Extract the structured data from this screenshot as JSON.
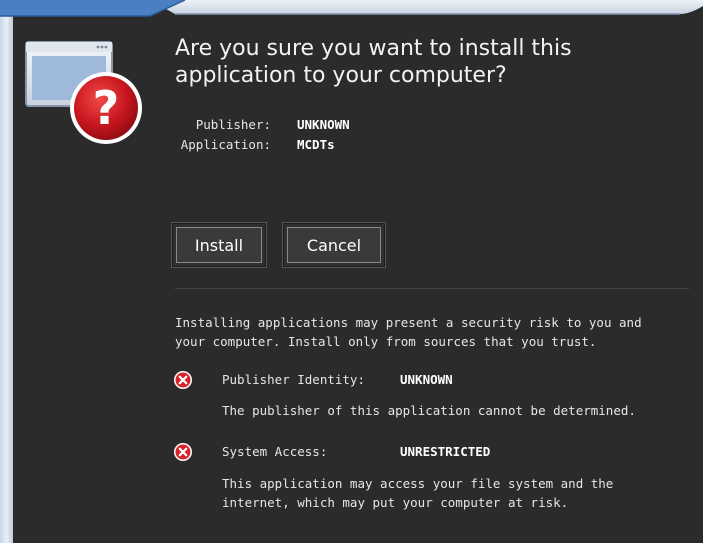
{
  "dialog": {
    "headline": "Are you sure you want to install this application to your computer?",
    "publisher_label": "Publisher:",
    "publisher_value": "UNKNOWN",
    "application_label": "Application:",
    "application_value": "MCDTs"
  },
  "buttons": {
    "install_label": "Install",
    "cancel_label": "Cancel"
  },
  "warning": {
    "line1": "Installing applications may present a security risk to you and",
    "line2": "your computer. Install only from sources that you trust."
  },
  "risks": [
    {
      "label": "Publisher Identity:",
      "value": "UNKNOWN",
      "description_line1": "The publisher of this application cannot be determined.",
      "description_line2": ""
    },
    {
      "label": "System Access:",
      "value": "UNRESTRICTED",
      "description_line1": "This application may access your file system and the",
      "description_line2": "internet, which may put your computer at risk."
    }
  ],
  "colors": {
    "background": "#2b2b2b",
    "risk_icon": "#d8232a",
    "question_icon": "#c8161e",
    "callout_blue": "#3f74b5"
  },
  "icons": {
    "app": "install-question-icon",
    "risk": "error-x-icon"
  }
}
